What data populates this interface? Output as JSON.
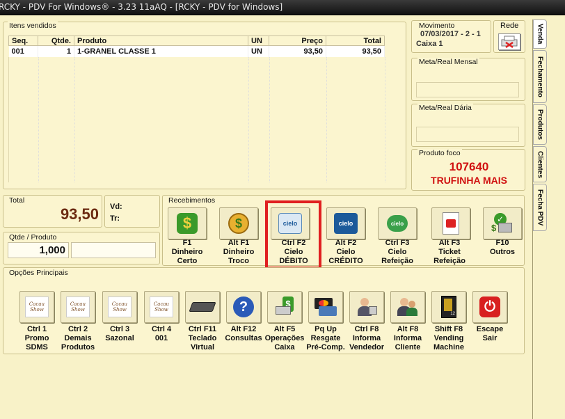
{
  "window": {
    "title": "RCKY - PDV For Windows® - 3.23 11aAQ - [RCKY - PDV for Windows]"
  },
  "items": {
    "legend": "Itens vendidos",
    "headers": {
      "seq": "Seq.",
      "qtde": "Qtde.",
      "produto": "Produto",
      "un": "UN",
      "preco": "Preço",
      "total": "Total"
    },
    "rows": [
      {
        "seq": "001",
        "qtde": "1",
        "produto": "1-GRANEL CLASSE 1",
        "un": "UN",
        "preco": "93,50",
        "total": "93,50"
      }
    ]
  },
  "movimento": {
    "legend": "Movimento",
    "date": "07/03/2017 - 2 - 1",
    "caixa": "Caixa 1"
  },
  "rede": {
    "label": "Rede"
  },
  "meta_mensal": {
    "legend": "Meta/Real Mensal"
  },
  "meta_diaria": {
    "legend": "Meta/Real Dária"
  },
  "produto_foco": {
    "legend": "Produto foco",
    "code": "107640",
    "name": "TRUFINHA MAIS"
  },
  "tabs": [
    "Venda",
    "Fechamento",
    "Produtos",
    "Clientes",
    "Fecha PDV"
  ],
  "total": {
    "legend": "Total",
    "value": "93,50"
  },
  "vd": {
    "label": "Vd:"
  },
  "tr": {
    "label": "Tr:"
  },
  "qtde": {
    "legend": "Qtde / Produto",
    "value": "1,000"
  },
  "recebimentos": {
    "legend": "Recebimentos",
    "buttons": [
      {
        "line1": "F1",
        "line2": "Dinheiro",
        "line3": "Certo",
        "icon": "dollar-icon"
      },
      {
        "line1": "Alt F1",
        "line2": "Dinheiro",
        "line3": "Troco",
        "icon": "coins-icon"
      },
      {
        "line1": "Ctrl F2",
        "line2": "Cielo",
        "line3": "DÉBITO",
        "icon": "cielo-debit-card-icon"
      },
      {
        "line1": "Alt F2",
        "line2": "Cielo",
        "line3": "CRÉDITO",
        "icon": "cielo-credit-card-icon"
      },
      {
        "line1": "Ctrl F3",
        "line2": "Cielo",
        "line3": "Refeição",
        "icon": "cielo-meal-icon"
      },
      {
        "line1": "Alt F3",
        "line2": "Ticket",
        "line3": "Refeição",
        "icon": "ticket-icon"
      },
      {
        "line1": "F10",
        "line2": "Outros",
        "line3": "",
        "icon": "money-register-icon"
      }
    ]
  },
  "opcoes": {
    "legend": "Opções Principais",
    "buttons": [
      {
        "line1": "Ctrl 1",
        "line2": "Promo",
        "line3": "SDMS",
        "icon": "cacau-show-logo-icon"
      },
      {
        "line1": "Ctrl 2",
        "line2": "Demais",
        "line3": "Produtos",
        "icon": "cacau-show-logo-icon"
      },
      {
        "line1": "Ctrl 3",
        "line2": "Sazonal",
        "line3": "",
        "icon": "cacau-show-logo-icon"
      },
      {
        "line1": "Ctrl 4",
        "line2": "001",
        "line3": "",
        "icon": "cacau-show-logo-icon"
      },
      {
        "line1": "Ctrl F11",
        "line2": "Teclado",
        "line3": "Virtual",
        "icon": "keyboard-icon"
      },
      {
        "line1": "Alt F12",
        "line2": "Consultas",
        "line3": "",
        "icon": "help-icon"
      },
      {
        "line1": "Alt F5",
        "line2": "Operações",
        "line3": "Caixa",
        "icon": "cash-operations-icon"
      },
      {
        "line1": "Pq Up",
        "line2": "Resgate",
        "line3": "Pré-Comp.",
        "icon": "cards-icon"
      },
      {
        "line1": "Ctrl F8",
        "line2": "Informa",
        "line3": "Vendedor",
        "icon": "salesperson-icon"
      },
      {
        "line1": "Alt F8",
        "line2": "Informa",
        "line3": "Cliente",
        "icon": "client-icon"
      },
      {
        "line1": "Shift F8",
        "line2": "Vending",
        "line3": "Machine",
        "icon": "vending-machine-icon"
      },
      {
        "line1": "Escape",
        "line2": "Sair",
        "line3": "",
        "icon": "power-icon"
      }
    ]
  },
  "colors": {
    "highlight": "#e02020",
    "produto_foco": "#d01010",
    "total_value": "#6b2a10"
  }
}
